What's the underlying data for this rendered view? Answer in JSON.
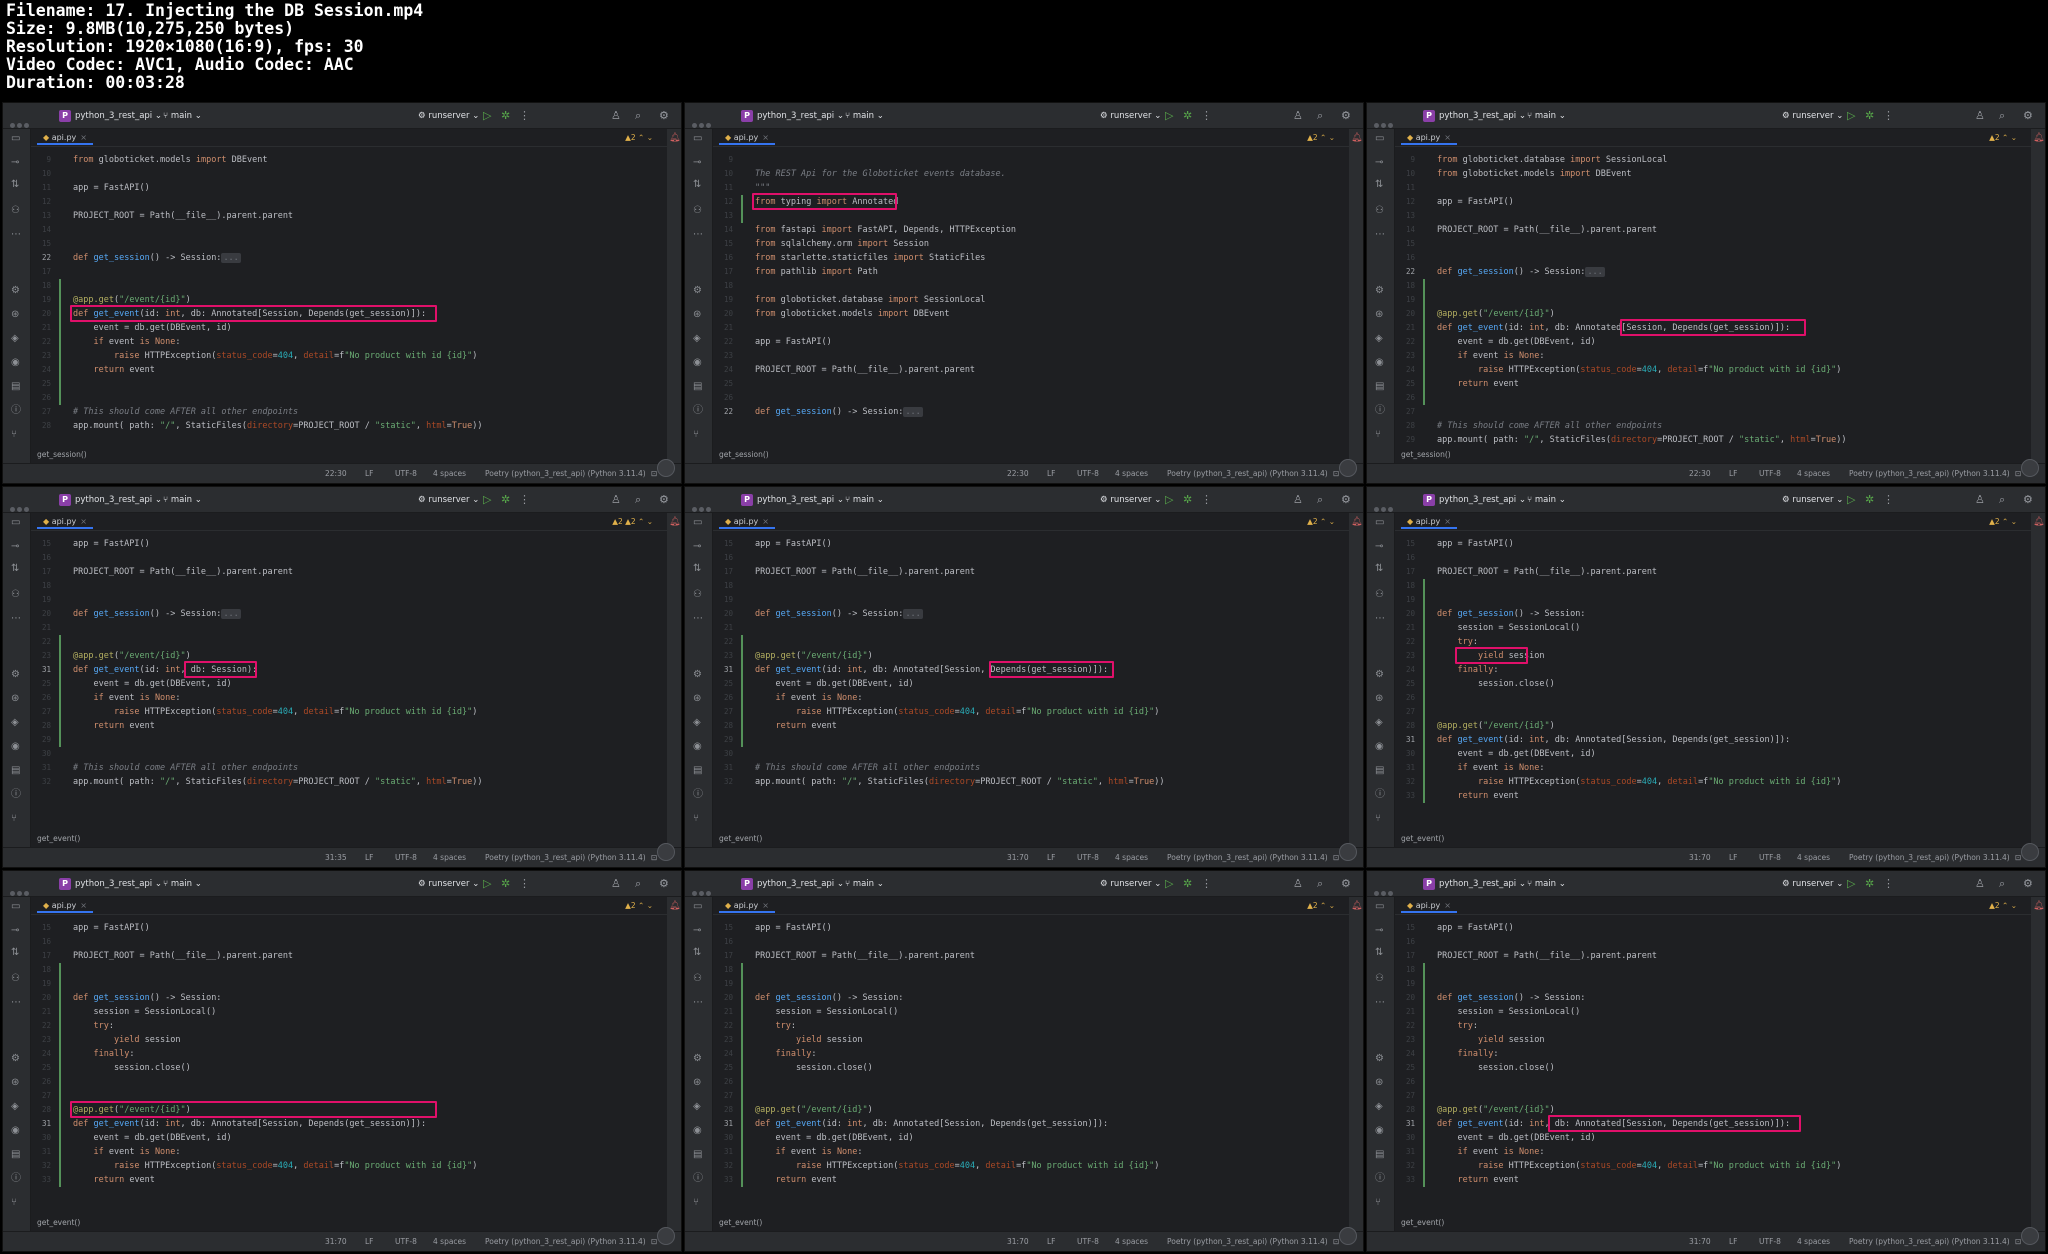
{
  "meta": {
    "filename": "Filename: 17. Injecting the DB Session.mp4",
    "size": "Size: 9.8MB(10,275,250 bytes)",
    "resolution": "Resolution: 1920×1080(16:9), fps: 30",
    "codec": "Video Codec: AVC1, Audio Codec: AAC",
    "duration": "Duration: 00:03:28"
  },
  "ide": {
    "project": "python_3_rest_api",
    "branch": "main",
    "run_config": "runserver",
    "tab": "api.py",
    "enc": "UTF-8",
    "le": "LF",
    "indent": "4 spaces",
    "interp": "Poetry (python_3_rest_api) (Python 3.11.4)"
  },
  "colors": {
    "highlight": "#e0106a",
    "editor_bg": "#1e1f22"
  },
  "panes": [
    {
      "pos": "22:30",
      "crumb": "get_session()",
      "warn": "▲2",
      "lines": [
        {
          "n": "",
          "t": "from globoticket.models import DBEvent"
        },
        {
          "n": "",
          "t": ""
        },
        {
          "n": "",
          "t": "app = FastAPI()"
        },
        {
          "n": "",
          "t": ""
        },
        {
          "n": "",
          "t": "PROJECT_ROOT = Path(__file__).parent.parent"
        },
        {
          "n": "",
          "t": ""
        },
        {
          "n": "",
          "t": ""
        },
        {
          "n": "22",
          "t": "def get_session() -> Session:..."
        },
        {
          "n": "",
          "t": ""
        },
        {
          "n": "",
          "t": ""
        },
        {
          "n": "",
          "t": "@app.get(\"/event/{id}\")"
        },
        {
          "n": "",
          "t": "def get_event(id: int, db: Annotated[Session, Depends(get_session)]):"
        },
        {
          "n": "",
          "t": "    event = db.get(DBEvent, id)"
        },
        {
          "n": "",
          "t": "    if event is None:"
        },
        {
          "n": "",
          "t": "        raise HTTPException(status_code=404, detail=f\"No product with id {id}\")"
        },
        {
          "n": "",
          "t": "    return event"
        },
        {
          "n": "",
          "t": ""
        },
        {
          "n": "",
          "t": ""
        },
        {
          "n": "",
          "t": "# This should come AFTER all other endpoints"
        },
        {
          "n": "",
          "t": "app.mount( path: \"/\", StaticFiles(directory=PROJECT_ROOT / \"static\", html=True))"
        }
      ]
    },
    {
      "pos": "22:30",
      "crumb": "get_session()",
      "warn": "▲2",
      "lines": [
        {
          "n": "",
          "t": ""
        },
        {
          "n": "",
          "t": "The REST Api for the Globoticket events database."
        },
        {
          "n": "",
          "t": "\"\"\""
        },
        {
          "n": "",
          "t": "from typing import Annotated"
        },
        {
          "n": "",
          "t": ""
        },
        {
          "n": "",
          "t": "from fastapi import FastAPI, Depends, HTTPException"
        },
        {
          "n": "",
          "t": "from sqlalchemy.orm import Session"
        },
        {
          "n": "",
          "t": "from starlette.staticfiles import StaticFiles"
        },
        {
          "n": "",
          "t": "from pathlib import Path"
        },
        {
          "n": "",
          "t": ""
        },
        {
          "n": "",
          "t": "from globoticket.database import SessionLocal"
        },
        {
          "n": "",
          "t": "from globoticket.models import DBEvent"
        },
        {
          "n": "",
          "t": ""
        },
        {
          "n": "",
          "t": "app = FastAPI()"
        },
        {
          "n": "",
          "t": ""
        },
        {
          "n": "",
          "t": "PROJECT_ROOT = Path(__file__).parent.parent"
        },
        {
          "n": "",
          "t": ""
        },
        {
          "n": "",
          "t": ""
        },
        {
          "n": "22",
          "t": "def get_session() -> Session:..."
        }
      ]
    },
    {
      "pos": "22:30",
      "crumb": "get_session()",
      "warn": "▲2",
      "lines": [
        {
          "n": "",
          "t": "from globoticket.database import SessionLocal"
        },
        {
          "n": "",
          "t": "from globoticket.models import DBEvent"
        },
        {
          "n": "",
          "t": ""
        },
        {
          "n": "",
          "t": "app = FastAPI()"
        },
        {
          "n": "",
          "t": ""
        },
        {
          "n": "",
          "t": "PROJECT_ROOT = Path(__file__).parent.parent"
        },
        {
          "n": "",
          "t": ""
        },
        {
          "n": "",
          "t": ""
        },
        {
          "n": "22",
          "t": "def get_session() -> Session:..."
        },
        {
          "n": "",
          "t": ""
        },
        {
          "n": "",
          "t": ""
        },
        {
          "n": "",
          "t": "@app.get(\"/event/{id}\")"
        },
        {
          "n": "",
          "t": "def get_event(id: int, db: Annotated[Session, Depends(get_session)]):"
        },
        {
          "n": "",
          "t": "    event = db.get(DBEvent, id)"
        },
        {
          "n": "",
          "t": "    if event is None:"
        },
        {
          "n": "",
          "t": "        raise HTTPException(status_code=404, detail=f\"No product with id {id}\")"
        },
        {
          "n": "",
          "t": "    return event"
        },
        {
          "n": "",
          "t": ""
        },
        {
          "n": "",
          "t": ""
        },
        {
          "n": "",
          "t": "# This should come AFTER all other endpoints"
        },
        {
          "n": "",
          "t": "app.mount( path: \"/\", StaticFiles(directory=PROJECT_ROOT / \"static\", html=True))"
        }
      ]
    },
    {
      "pos": "31:35",
      "crumb": "get_event()",
      "warn": "▲2 ▲2",
      "lines": [
        {
          "n": "",
          "t": "app = FastAPI()"
        },
        {
          "n": "",
          "t": ""
        },
        {
          "n": "",
          "t": "PROJECT_ROOT = Path(__file__).parent.parent"
        },
        {
          "n": "",
          "t": ""
        },
        {
          "n": "",
          "t": ""
        },
        {
          "n": "",
          "t": "def get_session() -> Session:..."
        },
        {
          "n": "",
          "t": ""
        },
        {
          "n": "",
          "t": ""
        },
        {
          "n": "",
          "t": "@app.get(\"/event/{id}\")"
        },
        {
          "n": "31",
          "t": "def get_event(id: int, db: Session):"
        },
        {
          "n": "",
          "t": "    event = db.get(DBEvent, id)"
        },
        {
          "n": "",
          "t": "    if event is None:"
        },
        {
          "n": "",
          "t": "        raise HTTPException(status_code=404, detail=f\"No product with id {id}\")"
        },
        {
          "n": "",
          "t": "    return event"
        },
        {
          "n": "",
          "t": ""
        },
        {
          "n": "",
          "t": ""
        },
        {
          "n": "",
          "t": "# This should come AFTER all other endpoints"
        },
        {
          "n": "",
          "t": "app.mount( path: \"/\", StaticFiles(directory=PROJECT_ROOT / \"static\", html=True))"
        }
      ]
    },
    {
      "pos": "31:70",
      "crumb": "get_event()",
      "warn": "▲2",
      "lines": [
        {
          "n": "",
          "t": "app = FastAPI()"
        },
        {
          "n": "",
          "t": ""
        },
        {
          "n": "",
          "t": "PROJECT_ROOT = Path(__file__).parent.parent"
        },
        {
          "n": "",
          "t": ""
        },
        {
          "n": "",
          "t": ""
        },
        {
          "n": "",
          "t": "def get_session() -> Session:..."
        },
        {
          "n": "",
          "t": ""
        },
        {
          "n": "",
          "t": ""
        },
        {
          "n": "",
          "t": "@app.get(\"/event/{id}\")"
        },
        {
          "n": "31",
          "t": "def get_event(id: int, db: Annotated[Session, Depends(get_session)]):"
        },
        {
          "n": "",
          "t": "    event = db.get(DBEvent, id)"
        },
        {
          "n": "",
          "t": "    if event is None:"
        },
        {
          "n": "",
          "t": "        raise HTTPException(status_code=404, detail=f\"No product with id {id}\")"
        },
        {
          "n": "",
          "t": "    return event"
        },
        {
          "n": "",
          "t": ""
        },
        {
          "n": "",
          "t": ""
        },
        {
          "n": "",
          "t": "# This should come AFTER all other endpoints"
        },
        {
          "n": "",
          "t": "app.mount( path: \"/\", StaticFiles(directory=PROJECT_ROOT / \"static\", html=True))"
        }
      ]
    },
    {
      "pos": "31:70",
      "crumb": "get_event()",
      "warn": "▲2",
      "lines": [
        {
          "n": "",
          "t": "app = FastAPI()"
        },
        {
          "n": "",
          "t": ""
        },
        {
          "n": "",
          "t": "PROJECT_ROOT = Path(__file__).parent.parent"
        },
        {
          "n": "",
          "t": ""
        },
        {
          "n": "",
          "t": ""
        },
        {
          "n": "",
          "t": "def get_session() -> Session:"
        },
        {
          "n": "",
          "t": "    session = SessionLocal()"
        },
        {
          "n": "",
          "t": "    try:"
        },
        {
          "n": "",
          "t": "        yield session"
        },
        {
          "n": "",
          "t": "    finally:"
        },
        {
          "n": "",
          "t": "        session.close()"
        },
        {
          "n": "",
          "t": ""
        },
        {
          "n": "",
          "t": ""
        },
        {
          "n": "",
          "t": "@app.get(\"/event/{id}\")"
        },
        {
          "n": "31",
          "t": "def get_event(id: int, db: Annotated[Session, Depends(get_session)]):"
        },
        {
          "n": "",
          "t": "    event = db.get(DBEvent, id)"
        },
        {
          "n": "",
          "t": "    if event is None:"
        },
        {
          "n": "",
          "t": "        raise HTTPException(status_code=404, detail=f\"No product with id {id}\")"
        },
        {
          "n": "",
          "t": "    return event"
        }
      ]
    },
    {
      "pos": "31:70",
      "crumb": "get_event()",
      "warn": "▲2",
      "lines": [
        {
          "n": "",
          "t": "app = FastAPI()"
        },
        {
          "n": "",
          "t": ""
        },
        {
          "n": "",
          "t": "PROJECT_ROOT = Path(__file__).parent.parent"
        },
        {
          "n": "",
          "t": ""
        },
        {
          "n": "",
          "t": ""
        },
        {
          "n": "",
          "t": "def get_session() -> Session:"
        },
        {
          "n": "",
          "t": "    session = SessionLocal()"
        },
        {
          "n": "",
          "t": "    try:"
        },
        {
          "n": "",
          "t": "        yield session"
        },
        {
          "n": "",
          "t": "    finally:"
        },
        {
          "n": "",
          "t": "        session.close()"
        },
        {
          "n": "",
          "t": ""
        },
        {
          "n": "",
          "t": ""
        },
        {
          "n": "",
          "t": "@app.get(\"/event/{id}\")"
        },
        {
          "n": "31",
          "t": "def get_event(id: int, db: Annotated[Session, Depends(get_session)]):"
        },
        {
          "n": "",
          "t": "    event = db.get(DBEvent, id)"
        },
        {
          "n": "",
          "t": "    if event is None:"
        },
        {
          "n": "",
          "t": "        raise HTTPException(status_code=404, detail=f\"No product with id {id}\")"
        },
        {
          "n": "",
          "t": "    return event"
        }
      ]
    },
    {
      "pos": "31:70",
      "crumb": "get_event()",
      "warn": "▲2",
      "lines": [
        {
          "n": "",
          "t": "app = FastAPI()"
        },
        {
          "n": "",
          "t": ""
        },
        {
          "n": "",
          "t": "PROJECT_ROOT = Path(__file__).parent.parent"
        },
        {
          "n": "",
          "t": ""
        },
        {
          "n": "",
          "t": ""
        },
        {
          "n": "",
          "t": "def get_session() -> Session:"
        },
        {
          "n": "",
          "t": "    session = SessionLocal()"
        },
        {
          "n": "",
          "t": "    try:"
        },
        {
          "n": "",
          "t": "        yield session"
        },
        {
          "n": "",
          "t": "    finally:"
        },
        {
          "n": "",
          "t": "        session.close()"
        },
        {
          "n": "",
          "t": ""
        },
        {
          "n": "",
          "t": ""
        },
        {
          "n": "",
          "t": "@app.get(\"/event/{id}\")"
        },
        {
          "n": "31",
          "t": "def get_event(id: int, db: Annotated[Session, Depends(get_session)]):"
        },
        {
          "n": "",
          "t": "    event = db.get(DBEvent, id)"
        },
        {
          "n": "",
          "t": "    if event is None:"
        },
        {
          "n": "",
          "t": "        raise HTTPException(status_code=404, detail=f\"No product with id {id}\")"
        },
        {
          "n": "",
          "t": "    return event"
        }
      ]
    },
    {
      "pos": "31:70",
      "crumb": "get_event()",
      "warn": "▲2",
      "lines": [
        {
          "n": "",
          "t": "app = FastAPI()"
        },
        {
          "n": "",
          "t": ""
        },
        {
          "n": "",
          "t": "PROJECT_ROOT = Path(__file__).parent.parent"
        },
        {
          "n": "",
          "t": ""
        },
        {
          "n": "",
          "t": ""
        },
        {
          "n": "",
          "t": "def get_session() -> Session:"
        },
        {
          "n": "",
          "t": "    session = SessionLocal()"
        },
        {
          "n": "",
          "t": "    try:"
        },
        {
          "n": "",
          "t": "        yield session"
        },
        {
          "n": "",
          "t": "    finally:"
        },
        {
          "n": "",
          "t": "        session.close()"
        },
        {
          "n": "",
          "t": ""
        },
        {
          "n": "",
          "t": ""
        },
        {
          "n": "",
          "t": "@app.get(\"/event/{id}\")"
        },
        {
          "n": "31",
          "t": "def get_event(id: int, db: Annotated[Session, Depends(get_session)]):"
        },
        {
          "n": "",
          "t": "    event = db.get(DBEvent, id)"
        },
        {
          "n": "",
          "t": "    if event is None:"
        },
        {
          "n": "",
          "t": "        raise HTTPException(status_code=404, detail=f\"No product with id {id}\")"
        },
        {
          "n": "",
          "t": "    return event"
        }
      ]
    }
  ]
}
